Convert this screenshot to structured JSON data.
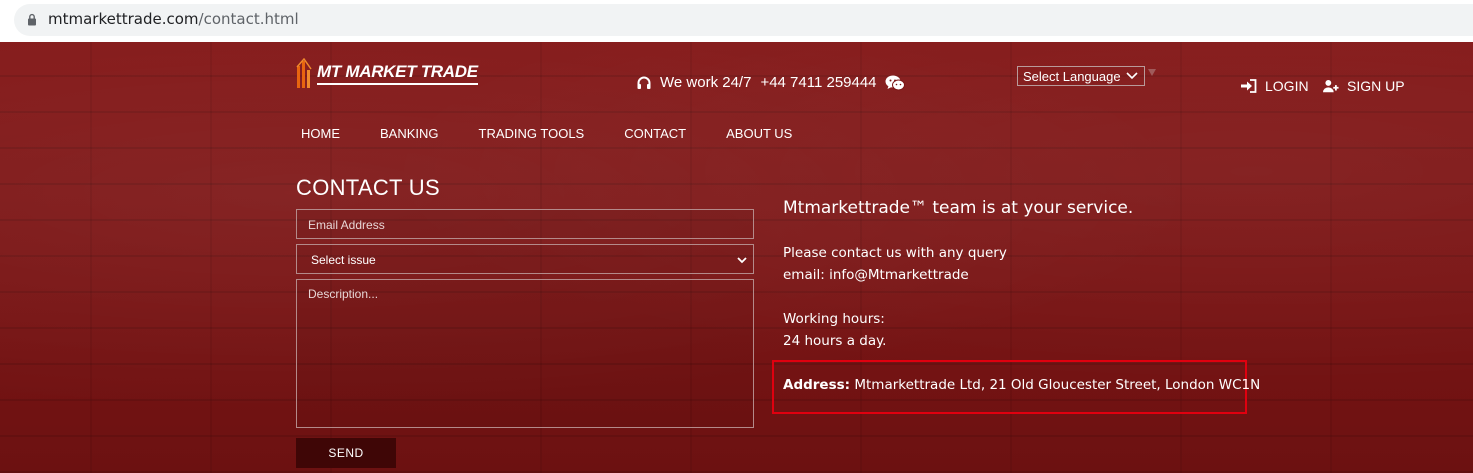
{
  "browser": {
    "url_host": "mtmarkettrade.com",
    "url_path": "/contact.html"
  },
  "header": {
    "logo_text": "MT MARKET TRADE",
    "work_text": "We work 24/7",
    "phone": "+44 7411 259444",
    "language_select": "Select Language",
    "login_label": "LOGIN",
    "signup_label": "SIGN UP"
  },
  "nav": {
    "items": [
      {
        "label": "HOME"
      },
      {
        "label": "BANKING"
      },
      {
        "label": "TRADING TOOLS"
      },
      {
        "label": "CONTACT"
      },
      {
        "label": "ABOUT US"
      }
    ]
  },
  "form": {
    "title": "CONTACT US",
    "email_placeholder": "Email Address",
    "issue_selected": "Select issue",
    "description_placeholder": "Description...",
    "send_label": "SEND"
  },
  "info": {
    "tagline": "Mtmarkettrade™ team is at your service.",
    "contact_line": "Please contact us with any query",
    "email_line": "email: info@Mtmarkettrade",
    "hours_label": "Working hours:",
    "hours_value": "24 hours a day.",
    "address_label": "Address:",
    "address_value": "Mtmarkettrade Ltd, 21 Old Gloucester Street, London WC1N"
  },
  "colors": {
    "background": "#7b1616",
    "send_button": "#3f0606",
    "highlight_box": "#e0000f",
    "logo_accent": "#e8650f"
  }
}
